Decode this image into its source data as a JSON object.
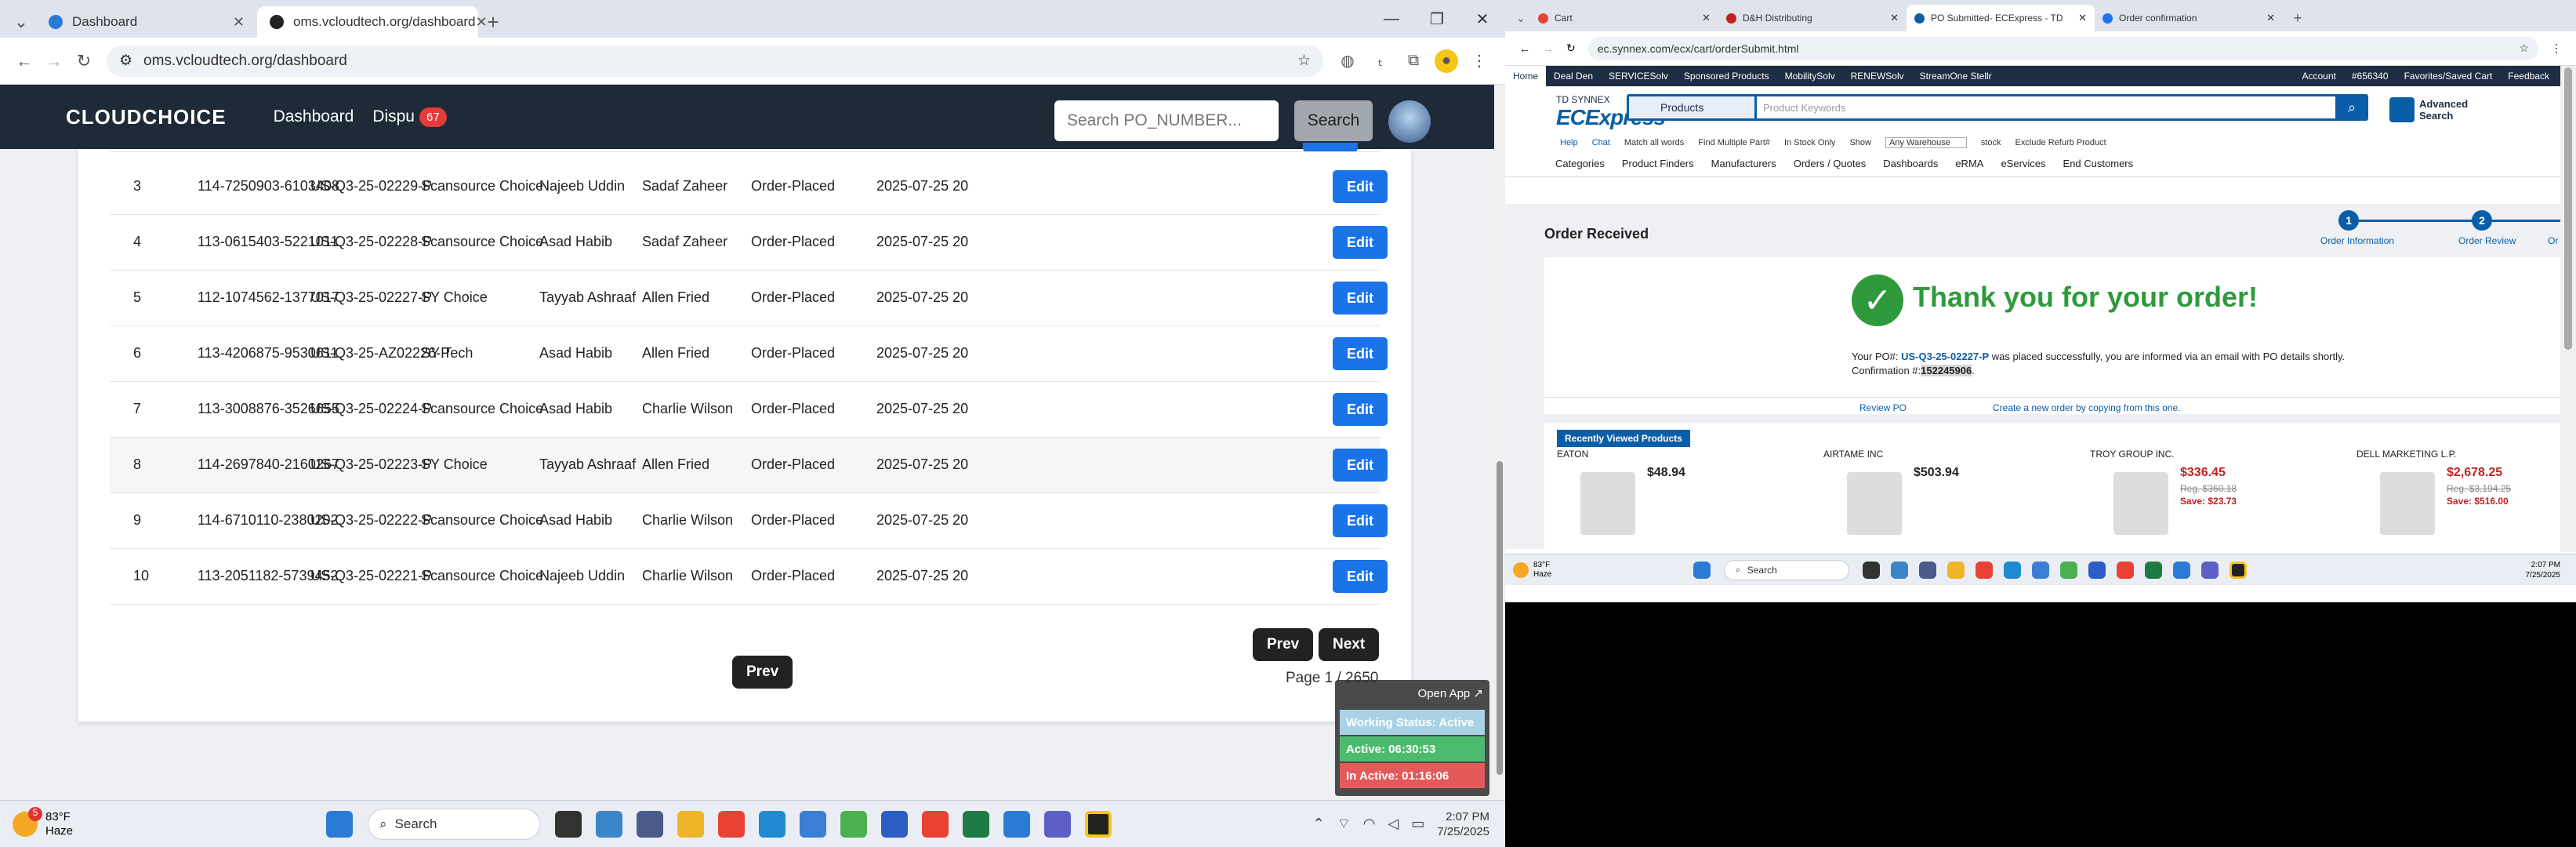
{
  "left_browser": {
    "tabs": [
      {
        "label": "Dashboard",
        "active": false
      },
      {
        "label": "oms.vcloudtech.org/dashboard",
        "active": true
      }
    ],
    "url": "oms.vcloudtech.org/dashboard"
  },
  "app": {
    "logo": "CLOUDCHOICE",
    "nav": [
      {
        "label": "Dashboard"
      },
      {
        "label": "Dispu"
      }
    ],
    "dispute_count": "67",
    "search_placeholder": "Search PO_NUMBER...",
    "search_button": "Search",
    "rows": [
      {
        "num": "3",
        "order": "114-7250903-6103408",
        "po": "US-Q3-25-02229-P",
        "vendor": "Scansource Choice",
        "agent": "Najeeb Uddin",
        "manager": "Sadaf Zaheer",
        "status": "Order-Placed",
        "date": "2025-07-25 20",
        "action": "Edit"
      },
      {
        "num": "4",
        "order": "113-0615403-5221011",
        "po": "US-Q3-25-02228-P",
        "vendor": "Scansource Choice",
        "agent": "Asad Habib",
        "manager": "Sadaf Zaheer",
        "status": "Order-Placed",
        "date": "2025-07-25 20",
        "action": "Edit"
      },
      {
        "num": "5",
        "order": "112-1074562-1377017",
        "po": "US-Q3-25-02227-P",
        "vendor": "SY Choice",
        "agent": "Tayyab Ashraaf",
        "manager": "Allen Fried",
        "status": "Order-Placed",
        "date": "2025-07-25 20",
        "action": "Edit"
      },
      {
        "num": "6",
        "order": "113-4206875-9530611",
        "po": "US-Q3-25-AZ02226-P",
        "vendor": "SY Tech",
        "agent": "Asad Habib",
        "manager": "Allen Fried",
        "status": "Order-Placed",
        "date": "2025-07-25 20",
        "action": "Edit"
      },
      {
        "num": "7",
        "order": "113-3008876-3526655",
        "po": "US-Q3-25-02224-P",
        "vendor": "Scansource Choice",
        "agent": "Asad Habib",
        "manager": "Charlie Wilson",
        "status": "Order-Placed",
        "date": "2025-07-25 20",
        "action": "Edit"
      },
      {
        "num": "8",
        "order": "114-2697840-2160267",
        "po": "US-Q3-25-02223-P",
        "vendor": "SY Choice",
        "agent": "Tayyab Ashraaf",
        "manager": "Allen Fried",
        "status": "Order-Placed",
        "date": "2025-07-25 20",
        "action": "Edit"
      },
      {
        "num": "9",
        "order": "114-6710110-2380202",
        "po": "US-Q3-25-02222-P",
        "vendor": "Scansource Choice",
        "agent": "Asad Habib",
        "manager": "Charlie Wilson",
        "status": "Order-Placed",
        "date": "2025-07-25 20",
        "action": "Edit"
      },
      {
        "num": "10",
        "order": "113-2051182-5739452",
        "po": "US-Q3-25-02221-P",
        "vendor": "Scansource Choice",
        "agent": "Najeeb Uddin",
        "manager": "Charlie Wilson",
        "status": "Order-Placed",
        "date": "2025-07-25 20",
        "action": "Edit"
      }
    ],
    "prev": "Prev",
    "next": "Next",
    "page_info": "Page 1 / 2650"
  },
  "status_widget": {
    "open_app": "Open App ↗",
    "working": "Working Status: Active",
    "active": "Active: 06:30:53",
    "inactive": "In Active: 01:16:06",
    "colors": {
      "working": "#a9d2e6",
      "active": "#4dbb6e",
      "inactive": "#e35a5a"
    }
  },
  "left_taskbar": {
    "weather_temp": "83°F",
    "weather_desc": "Haze",
    "weather_badge": "5",
    "search": "Search",
    "time": "2:07 PM",
    "date": "7/25/2025"
  },
  "right_browser": {
    "tabs": [
      {
        "label": "Cart"
      },
      {
        "label": "D&H Distributing"
      },
      {
        "label": "PO Submitted- ECExpress - TD"
      },
      {
        "label": "Order confirmation"
      }
    ],
    "url": "ec.synnex.com/ecx/cart/orderSubmit.html"
  },
  "synnex": {
    "top_nav": [
      "Home",
      "Deal Den",
      "SERVICESolv",
      "Sponsored Products",
      "MobilitySolv",
      "RENEWSolv",
      "StreamOne Stellr"
    ],
    "top_right": [
      "Account",
      "#656340",
      "Favorites/Saved Cart",
      "Feedback"
    ],
    "brand_small": "TD SYNNEX",
    "brand": "ECExpress",
    "search_category": "Products",
    "search_placeholder": "Product Keywords",
    "advanced": "Advanced Search",
    "options": [
      "Help",
      "Chat",
      "Match all words",
      "Find Multiple Part#",
      "In Stock Only",
      "Show",
      "Any Warehouse",
      "stock",
      "Exclude Refurb Product"
    ],
    "menu": [
      "Categories",
      "Product Finders",
      "Manufacturers",
      "Orders / Quotes",
      "Dashboards",
      "eRMA",
      "eServices",
      "End Customers"
    ],
    "order_received": "Order Received",
    "steps": [
      {
        "num": "1",
        "label": "Order Information"
      },
      {
        "num": "2",
        "label": "Order Review"
      },
      {
        "num": "",
        "label": "Or"
      }
    ],
    "thank_you": "Thank you for your order!",
    "po_prefix": "Your PO#:",
    "po_number": "US-Q3-25-02227-P",
    "po_mid": "was placed successfully, you are informed via an email with PO details shortly. Confirmation #:",
    "confirmation": "152245906",
    "review_po": "Review PO",
    "create_new": "Create a new order by copying from this one.",
    "recent": "Recently Viewed Products",
    "products": [
      {
        "vendor": "EATON",
        "price": "$48.94",
        "reg": "",
        "save": ""
      },
      {
        "vendor": "AIRTAME INC",
        "price": "$503.94",
        "reg": "",
        "save": ""
      },
      {
        "vendor": "TROY GROUP INC.",
        "price": "$336.45",
        "reg": "Reg. $360.18",
        "save": "Save: $23.73"
      },
      {
        "vendor": "DELL MARKETING L.P.",
        "price": "$2,678.25",
        "reg": "Reg. $3,194.25",
        "save": "Save: $516.00"
      }
    ]
  },
  "right_taskbar": {
    "weather_temp": "83°F",
    "weather_desc": "Haze",
    "search": "Search",
    "time": "2:07 PM",
    "date": "7/25/2025"
  }
}
